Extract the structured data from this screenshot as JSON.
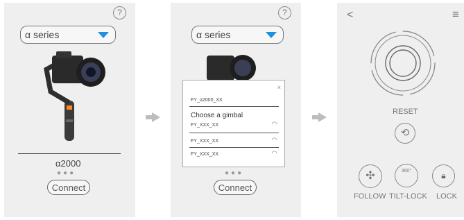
{
  "panel1": {
    "help_label": "?",
    "series_label": "α series",
    "model_label": "α2000",
    "dots": "●●●",
    "connect_label": "Connect"
  },
  "panel2": {
    "help_label": "?",
    "series_label": "α series",
    "dots": "●●●",
    "connect_label": "Connect",
    "popup": {
      "close_label": "×",
      "current_device": "FY_α2000_XX",
      "heading": "Choose a gimbal",
      "devices": [
        "FY_XXX_XX",
        "FY_XXX_XX",
        "FY_XXX_XX"
      ]
    }
  },
  "panel3": {
    "back_label": "<",
    "menu_label": "≡",
    "reset_label": "RESET",
    "follow_label": "FOLLOW",
    "tilt_lock_label": "TILT-LOCK",
    "tilt_badge": "360°",
    "lock_label": "LOCK"
  },
  "colors": {
    "panel_bg": "#efefef",
    "dropdown_arrow": "#1f8fe0",
    "flow_arrow": "#bdbdbd"
  }
}
